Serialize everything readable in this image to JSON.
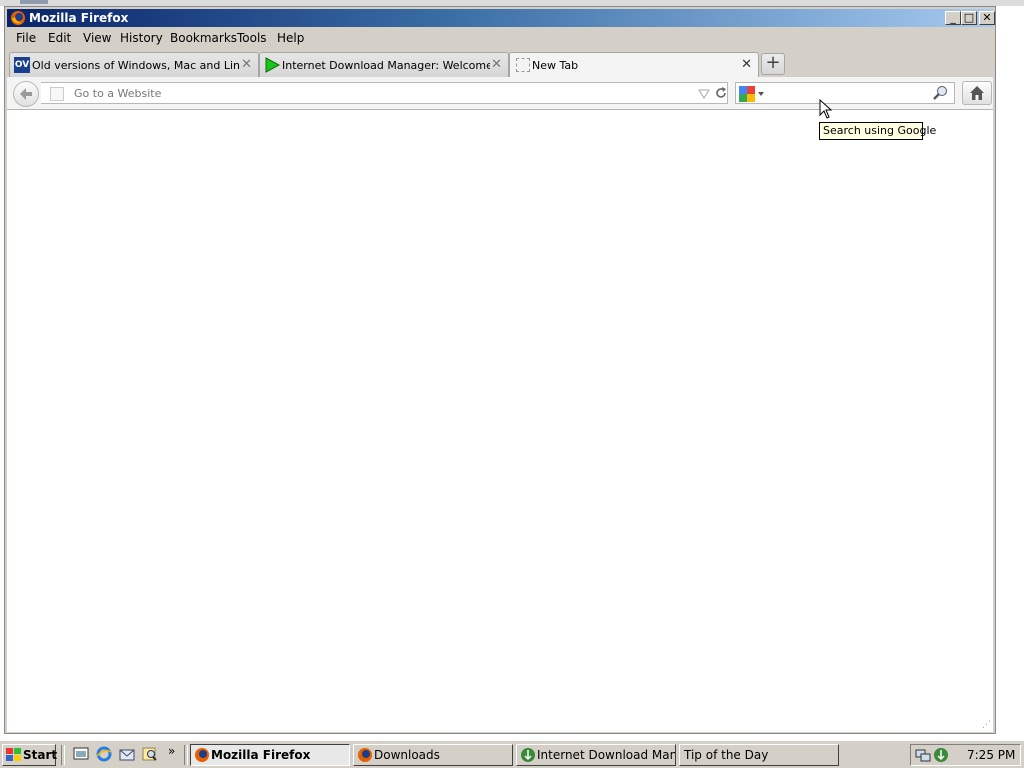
{
  "window": {
    "title": "Mozilla Firefox",
    "controls": {
      "minimize": "_",
      "maximize": "□",
      "close": "✕"
    }
  },
  "menubar": [
    "File",
    "Edit",
    "View",
    "History",
    "Bookmarks",
    "Tools",
    "Help"
  ],
  "tabs": [
    {
      "label": "Old versions of Windows, Mac and Linux ...",
      "favicon_text": "OV",
      "icon": "oldversion-favicon"
    },
    {
      "label": "Internet Download Manager: Welcome to...",
      "icon": "green-arrow-favicon"
    },
    {
      "label": "New Tab",
      "icon": "blank-page-favicon"
    }
  ],
  "new_tab_label": "+",
  "navbar": {
    "url_placeholder": "Go to a Website",
    "search_value": "",
    "tooltip": "Search using Google"
  },
  "taskbar": {
    "start_label": "Start",
    "quick_launch_more": "»",
    "buttons": [
      {
        "label": "Mozilla Firefox",
        "active": true
      },
      {
        "label": "Downloads",
        "active": false
      },
      {
        "label": "Internet Download Mana...",
        "active": false
      },
      {
        "label": "Tip of the Day",
        "active": false
      }
    ],
    "clock": "7:25 PM"
  },
  "colors": {
    "titlebar": "#0a246a",
    "tooltip_bg": "#ffffe1",
    "chrome": "#d4d0c8"
  }
}
